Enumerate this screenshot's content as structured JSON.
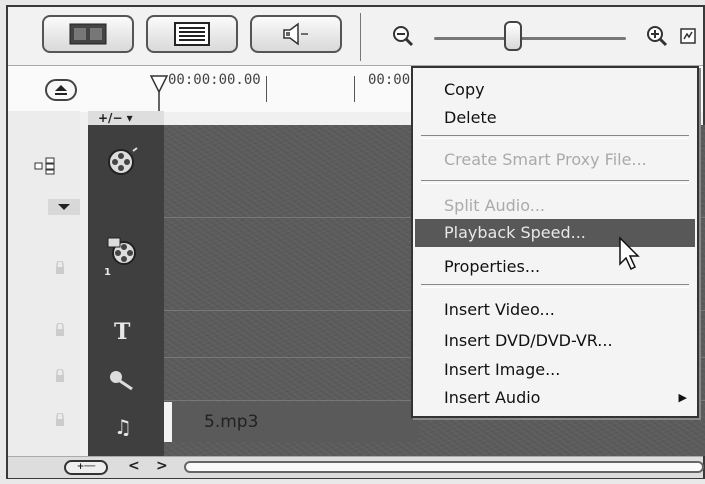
{
  "toolbar": {
    "zoom_out_icon": "zoom-out-icon",
    "zoom_in_icon": "zoom-in-icon",
    "zoom_slider_value": 0.42
  },
  "ruler": {
    "timecode_start": "00:00:00.00",
    "timecode_next": "00:00"
  },
  "tracks": {
    "add_remove_label": "+/− ▾",
    "title_track_label": "T",
    "music_track_label": "♫",
    "overlay_track_number": "1"
  },
  "timeline": {
    "audio_clip_name": "5.mp3"
  },
  "bottom_bar": {
    "add_button_label": "+──",
    "prev_label": "<",
    "next_label": ">"
  },
  "context_menu": {
    "items": [
      {
        "label": "Copy",
        "enabled": true
      },
      {
        "label": "Delete",
        "enabled": true
      },
      {
        "label": "Create Smart Proxy File...",
        "enabled": false
      },
      {
        "label": "Split Audio...",
        "enabled": false
      },
      {
        "label": "Playback Speed...",
        "enabled": true,
        "highlighted": true
      },
      {
        "label": "Properties...",
        "enabled": true
      },
      {
        "label": "Insert Video...",
        "enabled": true
      },
      {
        "label": "Insert DVD/DVD-VR...",
        "enabled": true
      },
      {
        "label": "Insert Image...",
        "enabled": true
      },
      {
        "label": "Insert Audio",
        "enabled": true,
        "submenu": true
      }
    ]
  },
  "colors": {
    "timeline_bg": "#5b5b5b",
    "highlight": "#585858",
    "menu_bg": "#f4f4f4"
  }
}
